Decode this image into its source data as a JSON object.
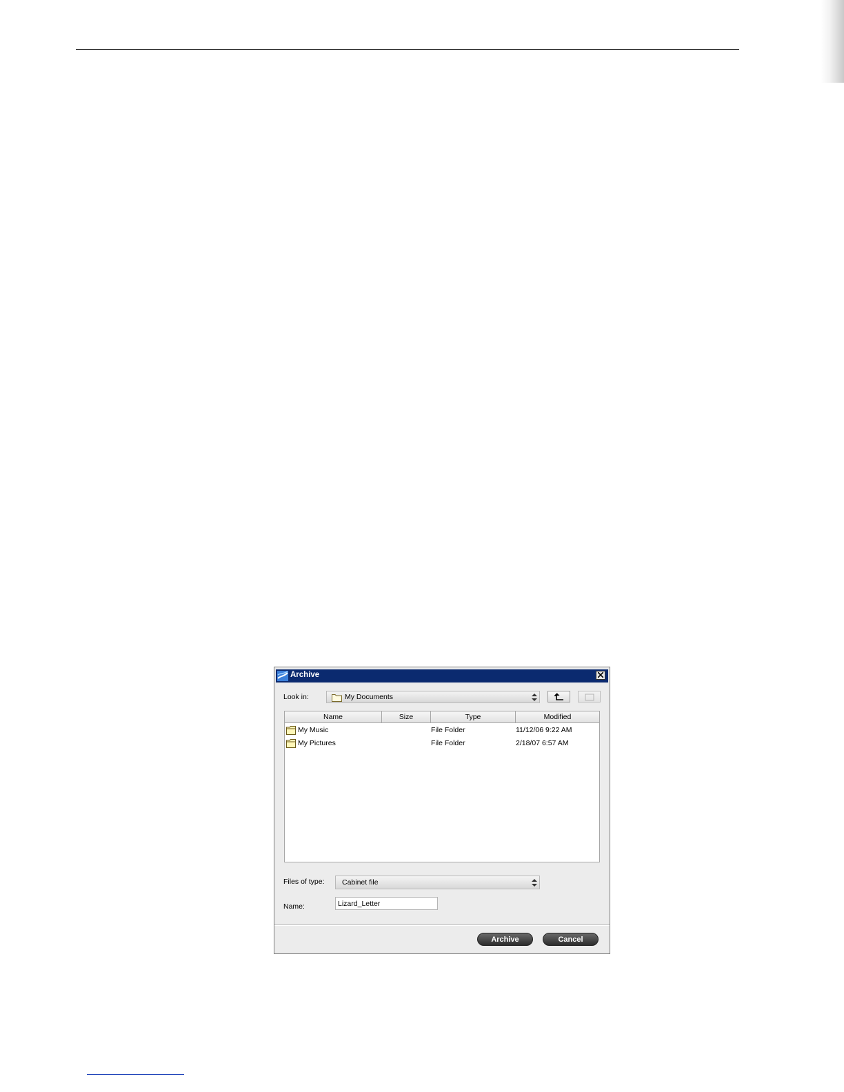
{
  "dialog": {
    "title": "Archive",
    "look_in_label": "Look in:",
    "look_in_value": "My Documents",
    "files_of_type_label": "Files of type:",
    "files_of_type_value": "Cabinet file",
    "name_label": "Name:",
    "name_value": "Lizard_Letter",
    "archive_button": "Archive",
    "cancel_button": "Cancel"
  },
  "file_list": {
    "columns": [
      "Name",
      "Size",
      "Type",
      "Modified"
    ],
    "rows": [
      {
        "name": "My Music",
        "size": "",
        "type": "File Folder",
        "modified": "11/12/06 9:22 AM",
        "icon": "folder-icon"
      },
      {
        "name": "My Pictures",
        "size": "",
        "type": "File Folder",
        "modified": "2/18/07 6:57 AM",
        "icon": "folder-icon"
      }
    ]
  },
  "colors": {
    "titlebar": "#0b2a6f",
    "dialog_background": "#ececec",
    "button_dark": "#2c2c2c"
  }
}
